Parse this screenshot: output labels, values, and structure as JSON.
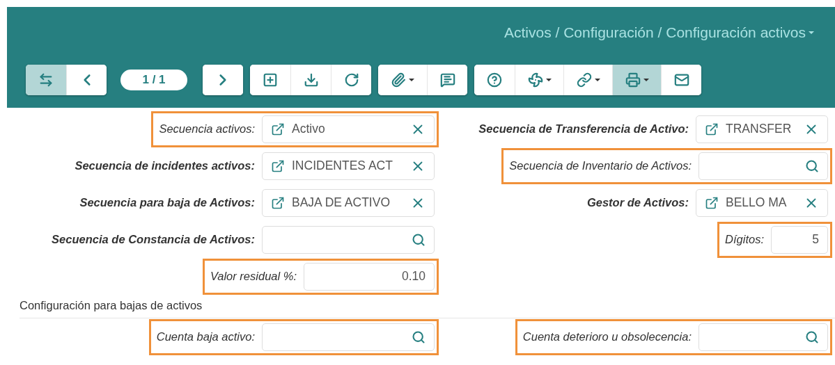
{
  "header": {
    "breadcrumb": "Activos / Configuración / Configuración activos"
  },
  "toolbar": {
    "groups": [
      {
        "buttons": [
          {
            "kind": "swap",
            "active": true,
            "dropdown": false
          },
          {
            "kind": "prev",
            "active": false,
            "dropdown": false
          }
        ]
      },
      {
        "pager": "1 / 1"
      },
      {
        "buttons": [
          {
            "kind": "next",
            "active": false,
            "dropdown": false
          }
        ]
      },
      {
        "buttons": [
          {
            "kind": "add",
            "active": false,
            "dropdown": false
          },
          {
            "kind": "download",
            "active": false,
            "dropdown": false
          },
          {
            "kind": "refresh",
            "active": false,
            "dropdown": false
          }
        ]
      },
      {
        "buttons": [
          {
            "kind": "attach",
            "active": false,
            "dropdown": true
          },
          {
            "kind": "comments",
            "active": false,
            "dropdown": false
          }
        ]
      },
      {
        "buttons": [
          {
            "kind": "help",
            "active": false,
            "dropdown": false
          },
          {
            "kind": "fan",
            "active": false,
            "dropdown": true
          },
          {
            "kind": "link",
            "active": false,
            "dropdown": true
          },
          {
            "kind": "print",
            "active": true,
            "dropdown": true
          },
          {
            "kind": "mail",
            "active": false,
            "dropdown": false
          }
        ]
      }
    ]
  },
  "form": {
    "rows": [
      {
        "left": {
          "label": "Secuencia activos:",
          "required": false,
          "highlighted": true,
          "kind": "link",
          "value": "Activo"
        },
        "right": {
          "label": "Secuencia de Transferencia de Activo:",
          "required": true,
          "highlighted": false,
          "kind": "link",
          "value": "TRANSFER"
        }
      },
      {
        "left": {
          "label": "Secuencia de incidentes activos:",
          "required": true,
          "highlighted": false,
          "kind": "link",
          "value": "INCIDENTES ACT"
        },
        "right": {
          "label": "Secuencia de Inventario de Activos:",
          "required": false,
          "highlighted": true,
          "kind": "search"
        }
      },
      {
        "left": {
          "label": "Secuencia para baja de Activos:",
          "required": true,
          "highlighted": false,
          "kind": "link",
          "value": "BAJA DE ACTIVO"
        },
        "right": {
          "label": "Gestor de Activos:",
          "required": true,
          "highlighted": false,
          "kind": "link",
          "value": "BELLO MA"
        }
      },
      {
        "left": {
          "label": "Secuencia de Constancia de Activos:",
          "required": true,
          "highlighted": false,
          "kind": "search"
        },
        "right": {
          "label": "Dígitos:",
          "required": false,
          "highlighted": true,
          "kind": "number",
          "value": "5"
        }
      },
      {
        "left": {
          "label": "Valor residual %:",
          "required": false,
          "highlighted": true,
          "kind": "number",
          "value": "0.10"
        }
      }
    ],
    "section": {
      "title": "Configuración para bajas de activos",
      "rows": [
        {
          "left": {
            "label": "Cuenta baja activo:",
            "required": false,
            "highlighted": true,
            "kind": "search"
          },
          "right": {
            "label": "Cuenta deterioro u obsolecencia:",
            "required": false,
            "highlighted": true,
            "kind": "search"
          }
        }
      ]
    }
  }
}
